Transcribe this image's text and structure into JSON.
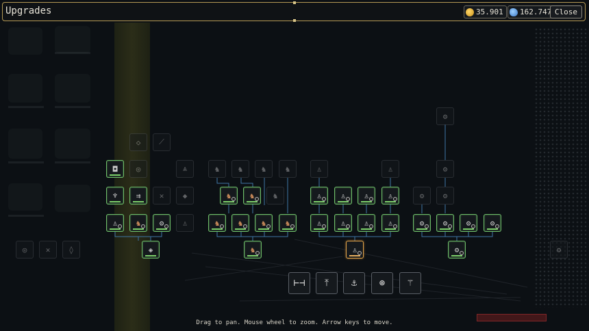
{
  "header": {
    "title": "Upgrades",
    "gold": "35.901",
    "essence": "162.747",
    "close_label": "Close"
  },
  "hint": "Drag to pan. Mouse wheel to zoom. Arrow keys to move.",
  "nodes": [
    {
      "name": "node-glyph-a",
      "icon": "◇",
      "state": "dim"
    },
    {
      "name": "node-glyph-b",
      "icon": "⟋",
      "state": "dim"
    },
    {
      "name": "node-square",
      "icon": "◘",
      "state": "owned"
    },
    {
      "name": "node-circle",
      "icon": "◎",
      "state": "dim"
    },
    {
      "name": "node-triangle",
      "icon": "⩓",
      "state": "dim"
    },
    {
      "name": "node-chain",
      "icon": "♆",
      "state": "owned"
    },
    {
      "name": "node-arrows",
      "icon": "⇉",
      "state": "owned"
    },
    {
      "name": "node-cross",
      "icon": "✕",
      "state": "dim"
    },
    {
      "name": "node-diamond",
      "icon": "◆",
      "state": "dim"
    }
  ],
  "icons": {
    "gold": "coin-icon",
    "essence": "gem-icon",
    "unit": "soldier-icon",
    "cannon": "cannon-icon"
  },
  "bottom_icons": [
    "⊢⊣",
    "⤒",
    "⚓",
    "⊛",
    "⚚"
  ],
  "left_icons": [
    "◎",
    "✕",
    "◊"
  ],
  "colors": {
    "owned": "#6fbf6a",
    "active": "#e6a64a",
    "border": "#b59a55"
  }
}
